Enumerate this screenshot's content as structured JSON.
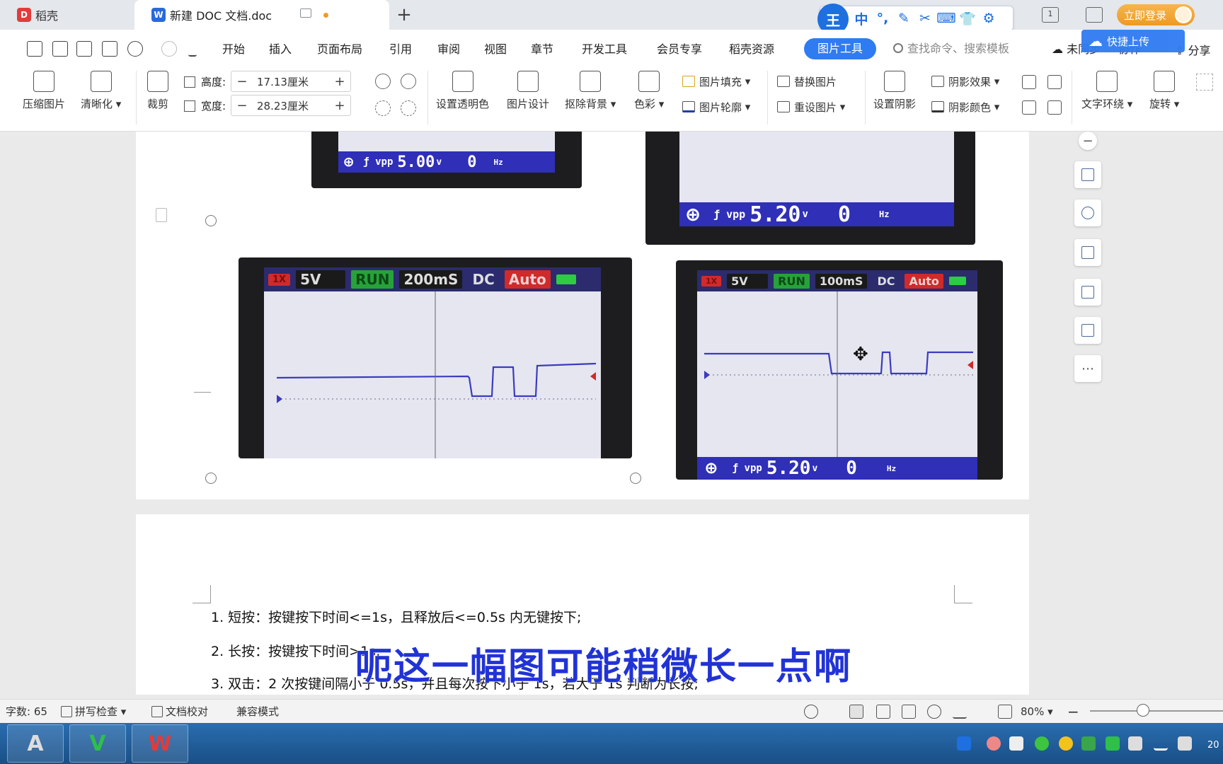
{
  "tabs": {
    "daoke": "稻壳",
    "doc": "新建 DOC 文档.doc",
    "new_tab": "+"
  },
  "ime": {
    "logo": "王",
    "mode": "中"
  },
  "window": {
    "login": "立即登录"
  },
  "menu": {
    "items": [
      "开始",
      "插入",
      "页面布局",
      "引用",
      "审阅",
      "视图",
      "章节",
      "开发工具",
      "会员专享",
      "稻壳资源"
    ],
    "active_tab": "图片工具",
    "search_placeholder": "查找命令、搜索模板",
    "sync": "未同步",
    "collab": "协作",
    "share": "分享",
    "cloud_upload": "快捷上传"
  },
  "ribbon": {
    "compress": "压缩图片",
    "clarify": "清晰化",
    "crop": "裁剪",
    "height_label": "高度:",
    "height_value": "17.13厘米",
    "width_label": "宽度:",
    "width_value": "28.23厘米",
    "minus": "−",
    "plus": "+",
    "transparent": "设置透明色",
    "design": "图片设计",
    "remove_bg": "抠除背景",
    "color": "色彩",
    "fill": "图片填充",
    "outline": "图片轮廓",
    "replace": "替换图片",
    "reset": "重设图片",
    "shadow_set": "设置阴影",
    "shadow_effect": "阴影效果",
    "shadow_color": "阴影颜色",
    "text_wrap": "文字环绕",
    "rotate": "旋转"
  },
  "scopes": {
    "top_left": {
      "vpp": "5.00",
      "freq": "0",
      "unit_v": "v",
      "unit_hz": "Hz"
    },
    "top_right": {
      "vpp": "5.20",
      "freq": "0",
      "unit_v": "v",
      "unit_hz": "Hz"
    },
    "bottom_left": {
      "probe": "1X",
      "volt": "5V",
      "run": "RUN",
      "time": "200mS",
      "coupling": "DC",
      "trigger": "Auto"
    },
    "bottom_right": {
      "probe": "1X",
      "volt": "5V",
      "run": "RUN",
      "time": "100mS",
      "coupling": "DC",
      "trigger": "Auto",
      "vpp": "5.20",
      "freq": "0",
      "unit_v": "v",
      "unit_hz": "Hz"
    }
  },
  "document": {
    "line1": "1. 短按：按键按下时间<=1s，且释放后<=0.5s 内无键按下;",
    "line2": "2. 长按：按键按下时间>1s;",
    "line3": "3. 双击：2 次按键间隔小于 0.5s，并且每次按下小于 1s，若大于 1s 判断为长按;"
  },
  "subtitle": "呃这一幅图可能稍微长一点啊",
  "status": {
    "word_count": "字数: 65",
    "spell": "拼写检查",
    "proof": "文档校对",
    "compat": "兼容模式",
    "zoom": "80%"
  },
  "taskbar": {
    "clock": "20"
  },
  "colors": {
    "accent": "#2f7bf2",
    "subtitle": "#2133d6",
    "scope_screen": "#e6e6f0",
    "trace": "#3b3bc0"
  }
}
